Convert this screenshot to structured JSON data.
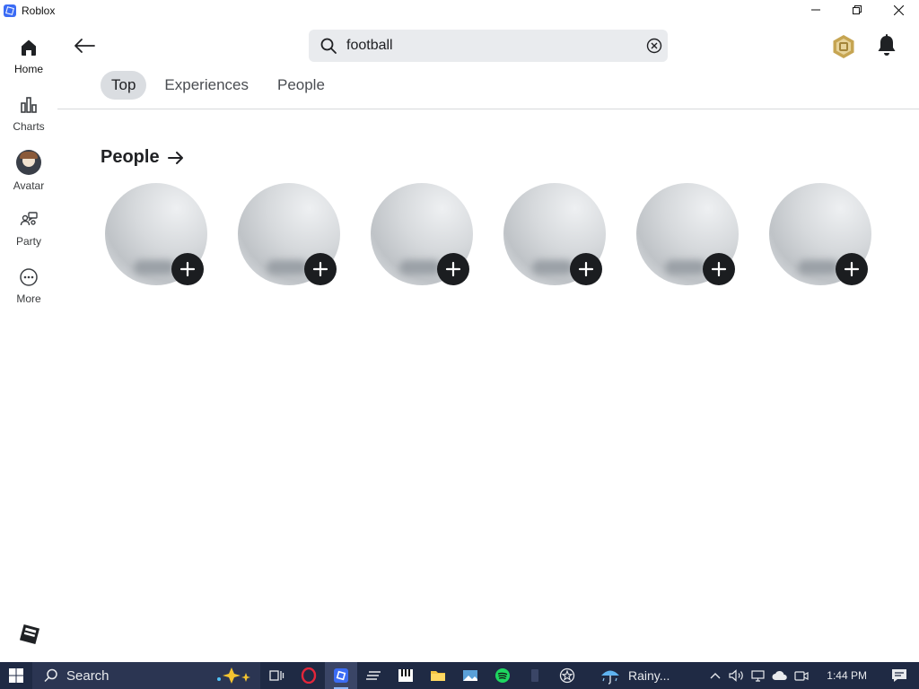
{
  "window": {
    "title": "Roblox"
  },
  "sidebar": {
    "items": [
      {
        "label": "Home",
        "icon": "home-icon",
        "active": true
      },
      {
        "label": "Charts",
        "icon": "charts-icon",
        "active": false
      },
      {
        "label": "Avatar",
        "icon": "avatar-icon",
        "active": false
      },
      {
        "label": "Party",
        "icon": "party-icon",
        "active": false
      },
      {
        "label": "More",
        "icon": "more-icon",
        "active": false
      }
    ]
  },
  "search": {
    "value": "football",
    "placeholder": ""
  },
  "tabs": [
    {
      "label": "Top",
      "active": true
    },
    {
      "label": "Experiences",
      "active": false
    },
    {
      "label": "People",
      "active": false
    }
  ],
  "people_section": {
    "title": "People",
    "cards": [
      {
        "id": 1
      },
      {
        "id": 2
      },
      {
        "id": 3
      },
      {
        "id": 4
      },
      {
        "id": 5
      },
      {
        "id": 6
      }
    ]
  },
  "taskbar": {
    "search_label": "Search",
    "weather": "Rainy...",
    "time": "1:44 PM"
  },
  "colors": {
    "accent": "#3b6cf5",
    "taskbar": "#1f2a44",
    "add_button": "#1b1d20",
    "robux": "#c6a552"
  }
}
